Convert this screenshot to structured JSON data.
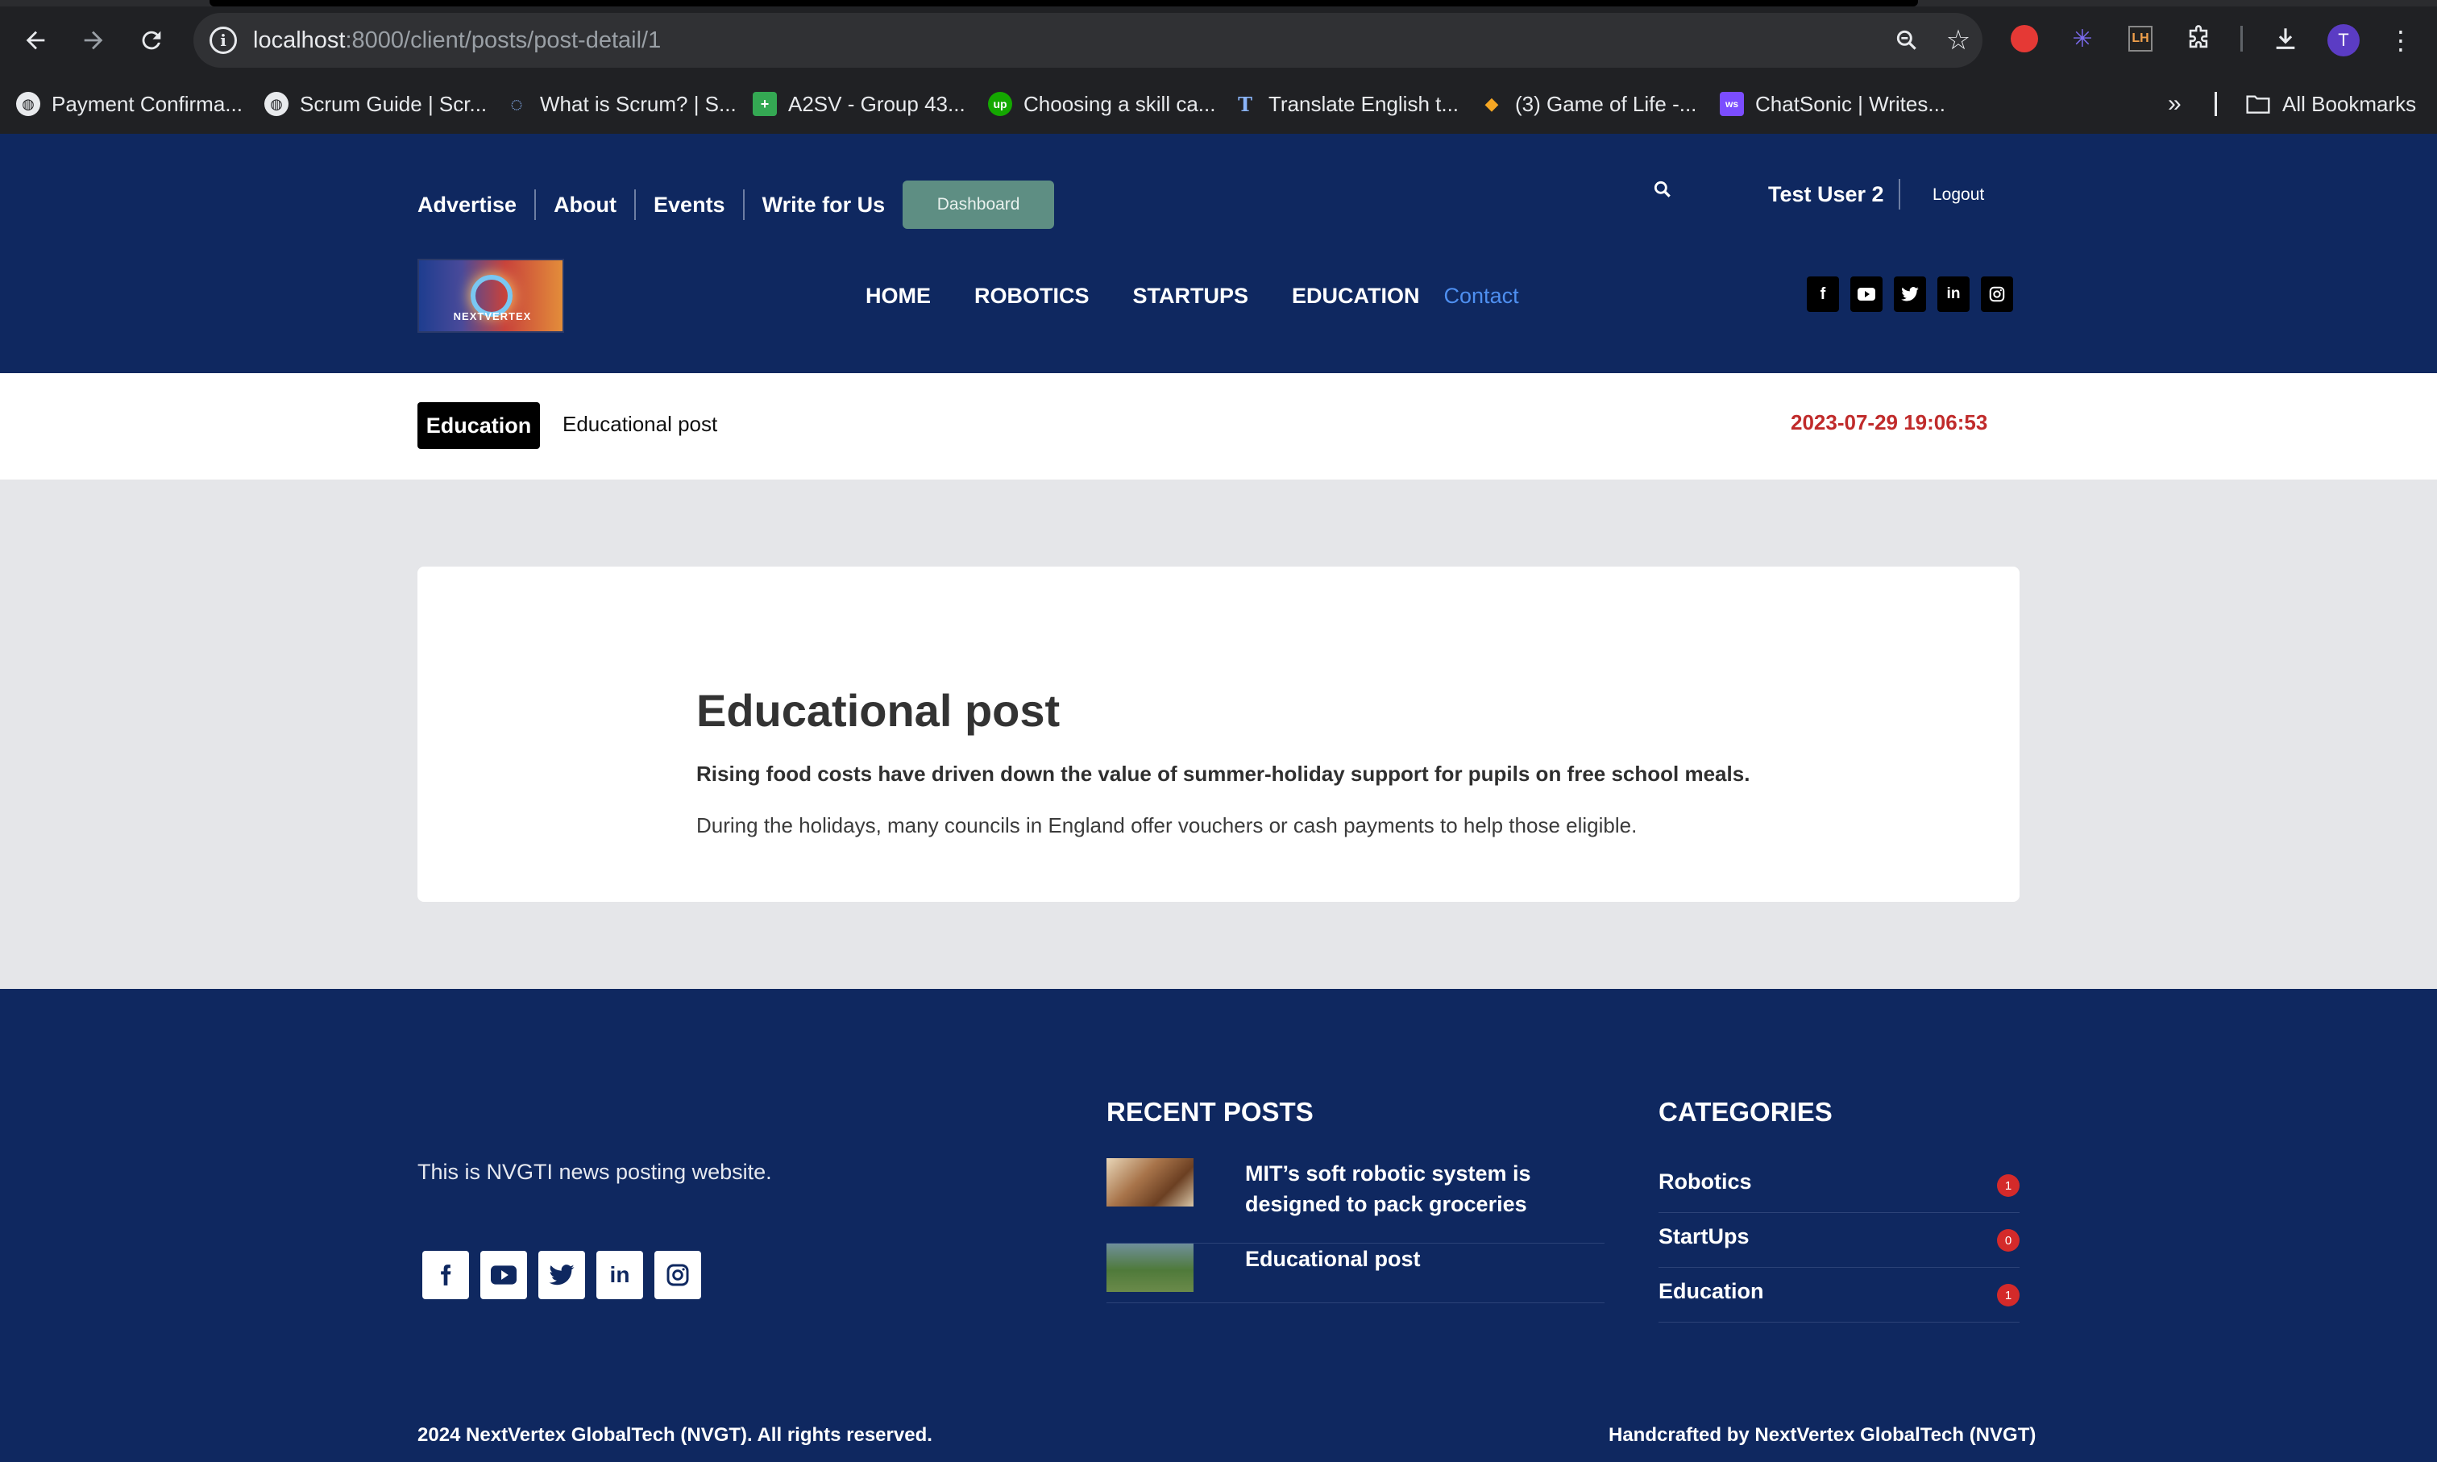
{
  "browser": {
    "url_host": "localhost",
    "url_path": ":8000/client/posts/post-detail/1",
    "bookmarks": [
      {
        "label": "Payment Confirma...",
        "icon": "globe-icon",
        "color": "#ffffff"
      },
      {
        "label": "Scrum Guide | Scr...",
        "icon": "globe-icon",
        "color": "#ffffff"
      },
      {
        "label": "What is Scrum? | S...",
        "icon": "scrum-icon",
        "color": "#8ab4f8"
      },
      {
        "label": "A2SV - Group 43...",
        "icon": "sheets-icon",
        "color": "#34a853"
      },
      {
        "label": "Choosing a skill ca...",
        "icon": "upwork-icon",
        "color": "#14a800"
      },
      {
        "label": "Translate English t...",
        "icon": "translate-icon",
        "color": "#8ab4f8"
      },
      {
        "label": "(3) Game of Life -...",
        "icon": "game-icon",
        "color": "#f5a623"
      },
      {
        "label": "ChatSonic | Writes...",
        "icon": "chatsonic-icon",
        "color": "#7b4dff"
      }
    ],
    "all_bookmarks_label": "All Bookmarks",
    "avatar_letter": "T"
  },
  "header": {
    "top_links": [
      "Advertise",
      "About",
      "Events",
      "Write for Us"
    ],
    "dashboard_label": "Dashboard",
    "user_name": "Test User 2",
    "logout_label": "Logout",
    "logo_text": "NEXTVERTEX",
    "main_nav": [
      "HOME",
      "ROBOTICS",
      "STARTUPS",
      "EDUCATION"
    ],
    "contact_label": "Contact",
    "social_icons": [
      "facebook-icon",
      "youtube-icon",
      "twitter-icon",
      "linkedin-icon",
      "instagram-icon"
    ]
  },
  "breadcrumb": {
    "category": "Education",
    "title": "Educational post",
    "date": "2023-07-29 19:06:53"
  },
  "article": {
    "title": "Educational post",
    "lead": "Rising food costs have driven down the value of summer-holiday support for pupils on free school meals.",
    "body": "During the holidays, many councils in England offer vouchers or cash payments to help those eligible."
  },
  "footer": {
    "about": "This is NVGTI news posting website.",
    "recent_heading": "RECENT POSTS",
    "recent_posts": [
      {
        "title": "MIT’s soft robotic system is designed to pack groceries"
      },
      {
        "title": "Educational post"
      }
    ],
    "categories_heading": "CATEGORIES",
    "categories": [
      {
        "name": "Robotics",
        "count": "1"
      },
      {
        "name": "StartUps",
        "count": "0"
      },
      {
        "name": "Education",
        "count": "1"
      }
    ],
    "copyright": "2024 NextVertex GlobalTech (NVGT). All rights reserved.",
    "handcrafted": "Handcrafted by NextVertex GlobalTech (NVGT)"
  },
  "colors": {
    "brand_navy": "#0f2860",
    "dashboard_green": "#5e8e83",
    "contact_blue": "#4e8ff0",
    "date_red": "#c02b2b",
    "badge_red": "#d42a2a"
  }
}
